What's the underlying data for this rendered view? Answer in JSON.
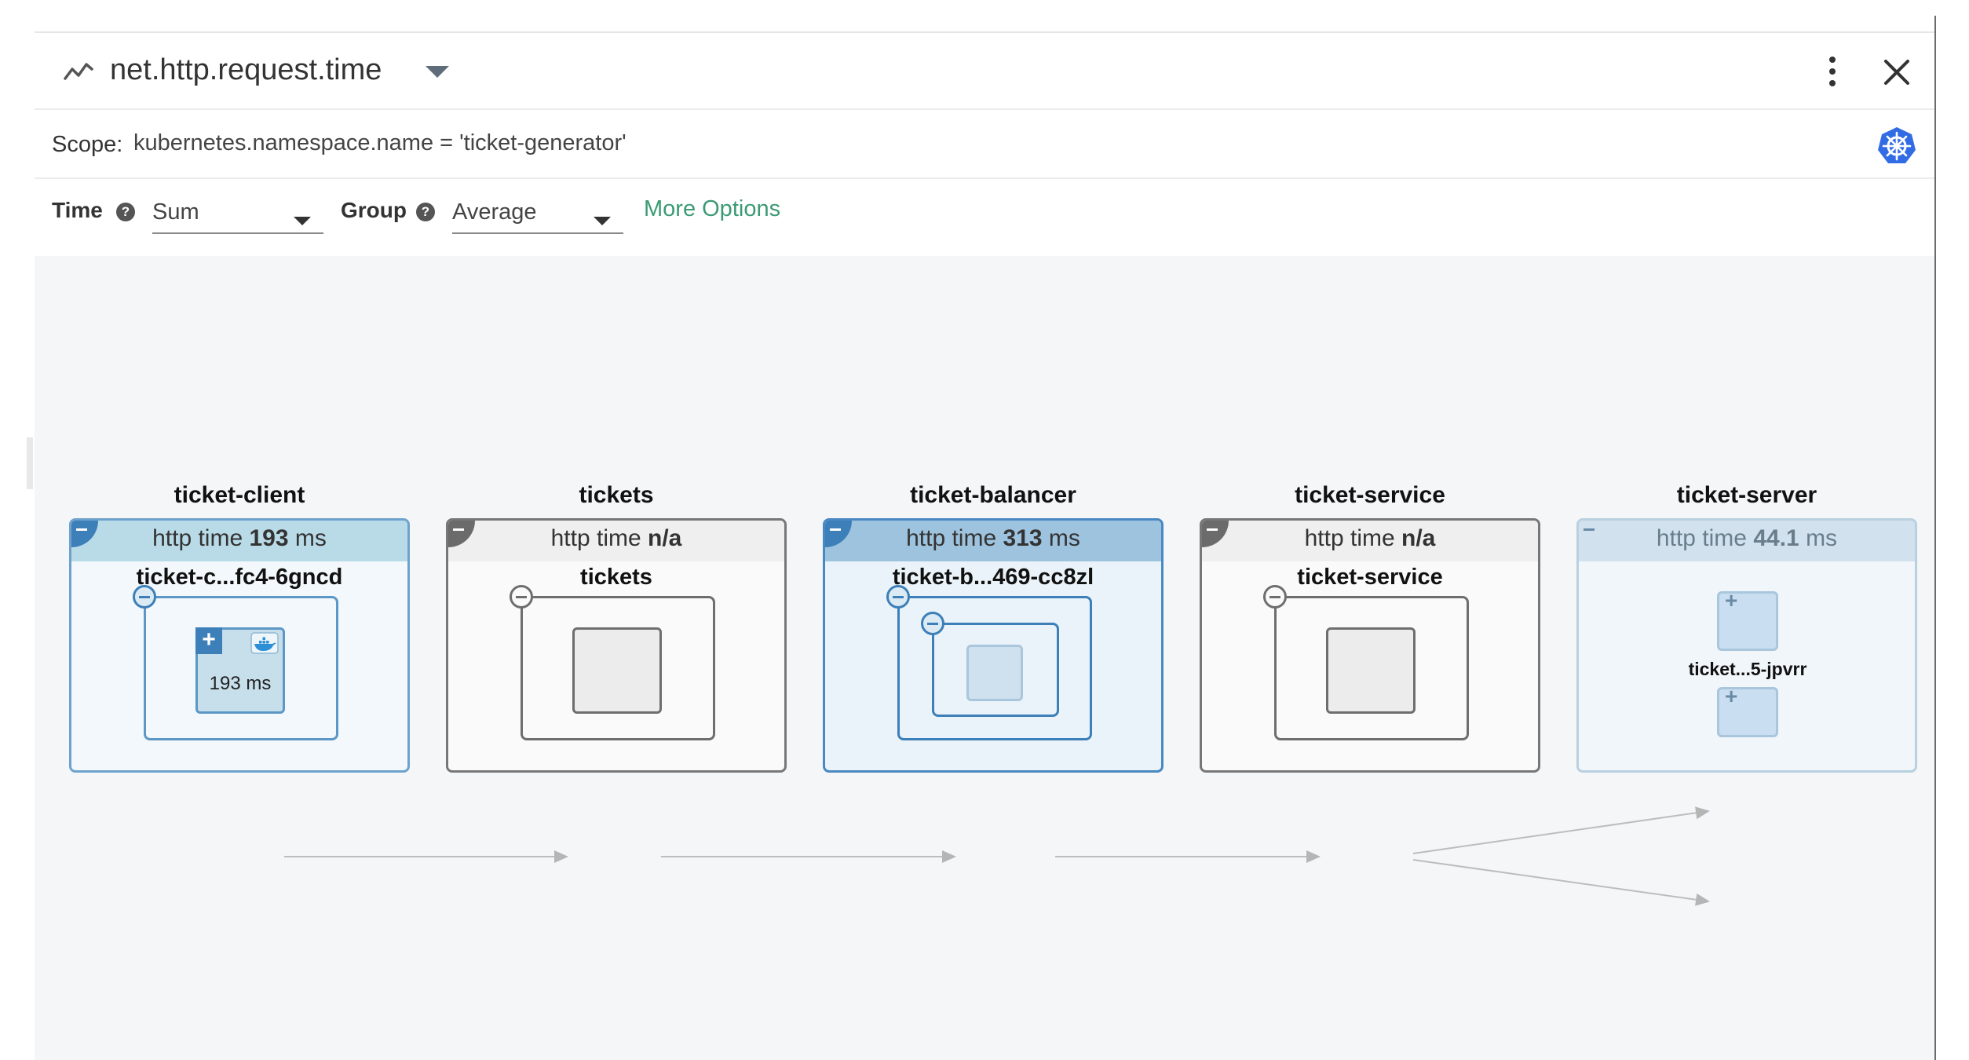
{
  "header": {
    "title": "net.http.request.time",
    "metric_icon": "line-chart-icon",
    "menu_icon": "kebab-menu-icon",
    "close_icon": "close-icon"
  },
  "scope": {
    "label": "Scope:",
    "value": "kubernetes.namespace.name = 'ticket-generator'",
    "icon": "kubernetes-icon"
  },
  "options": {
    "time_label": "Time",
    "time_value": "Sum",
    "group_label": "Group",
    "group_value": "Average",
    "help_glyph": "?",
    "more_options": "More Options"
  },
  "colors": {
    "accent_green": "#3b9a74",
    "k8s_blue": "#326ce5",
    "node_blue": "#4a88c2"
  },
  "topology": {
    "metric_prefix": "http time",
    "nodes": [
      {
        "title": "ticket-client",
        "metric_value": "193",
        "metric_unit": "ms",
        "sub": "ticket-c...fc4-6gncd",
        "container_value": "193 ms"
      },
      {
        "title": "tickets",
        "metric_value": "n/a",
        "metric_unit": "",
        "sub": "tickets"
      },
      {
        "title": "ticket-balancer",
        "metric_value": "313",
        "metric_unit": "ms",
        "sub": "ticket-b...469-cc8zl"
      },
      {
        "title": "ticket-service",
        "metric_value": "n/a",
        "metric_unit": "",
        "sub": "ticket-service"
      },
      {
        "title": "ticket-server",
        "metric_value": "44.1",
        "metric_unit": "ms",
        "sub": "",
        "pod_label": "ticket...5-jpvrr"
      }
    ]
  }
}
